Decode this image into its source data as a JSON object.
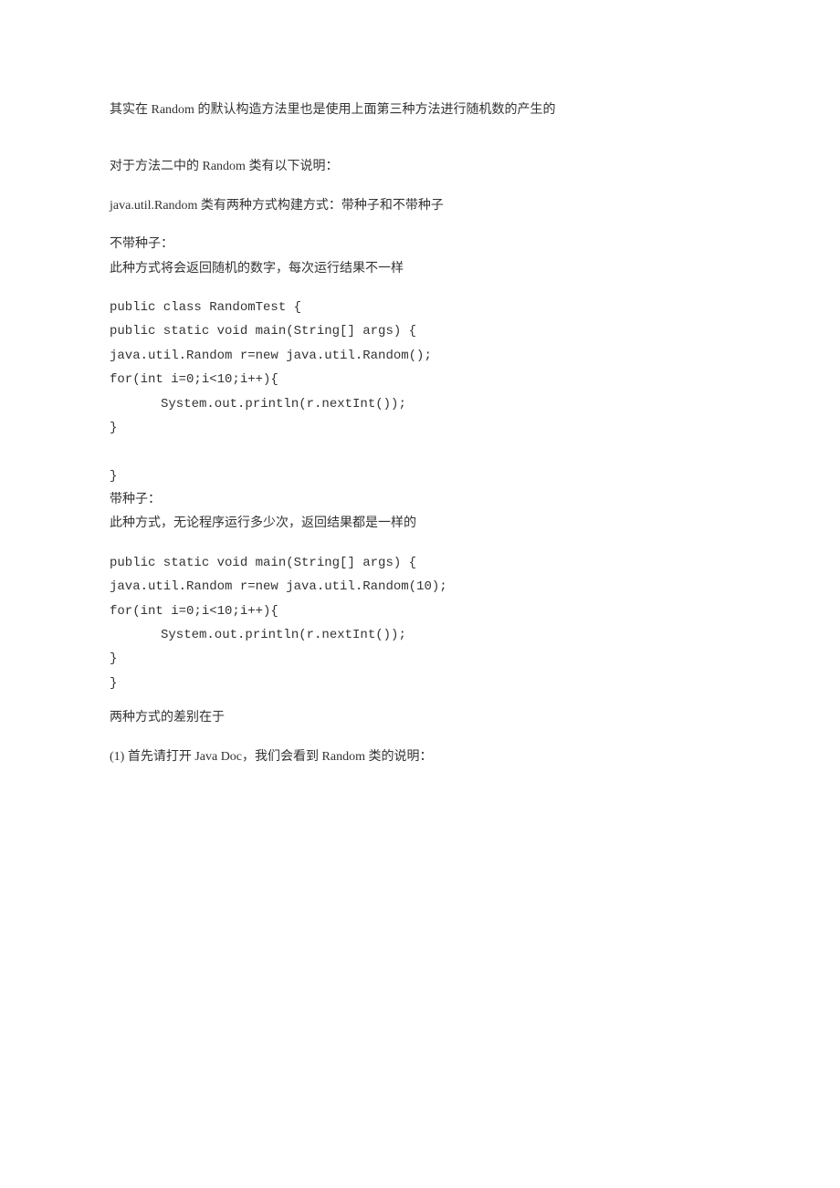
{
  "lines": {
    "l1": "其实在 Random 的默认构造方法里也是使用上面第三种方法进行随机数的产生的",
    "l2": "对于方法二中的 Random 类有以下说明：",
    "l3": "java.util.Random 类有两种方式构建方式：带种子和不带种子",
    "l4": "不带种子：",
    "l5": "此种方式将会返回随机的数字，每次运行结果不一样",
    "l6": "public class RandomTest {",
    "l7": "public static void main(String[] args) {",
    "l8": "java.util.Random r=new java.util.Random();",
    "l9": "for(int i=0;i<10;i++){",
    "l10": "System.out.println(r.nextInt());",
    "l11": "}",
    "l12": "}",
    "l13": "带种子：",
    "l14": "此种方式，无论程序运行多少次，返回结果都是一样的",
    "l15": "public static void main(String[] args) {",
    "l16": "java.util.Random r=new java.util.Random(10);",
    "l17": "for(int i=0;i<10;i++){",
    "l18": "System.out.println(r.nextInt());",
    "l19": "}",
    "l20": "}",
    "l21": "两种方式的差别在于",
    "l22": "(1) 首先请打开 Java Doc，我们会看到 Random 类的说明："
  }
}
